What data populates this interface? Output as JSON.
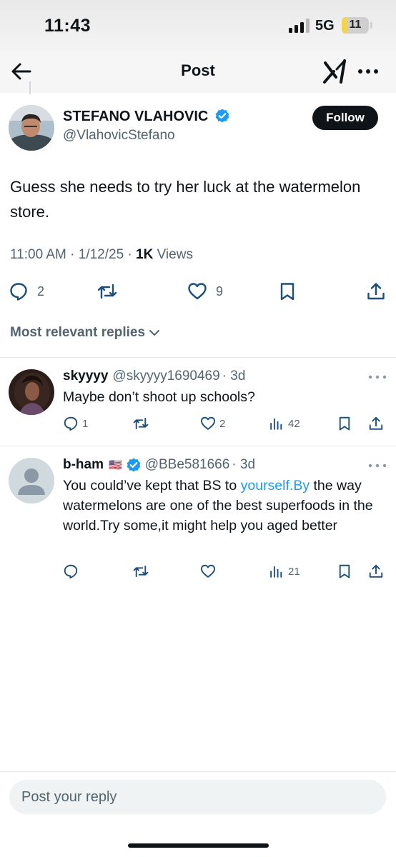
{
  "status_bar": {
    "time": "11:43",
    "network": "5G",
    "battery": "11",
    "battery_level": 0.11,
    "battery_color": "#f2d54b"
  },
  "nav": {
    "title": "Post",
    "icons": [
      "back-arrow-icon",
      "grok-icon",
      "more-icon"
    ]
  },
  "post": {
    "author_name": "STEFANO VLAHOVIC",
    "author_handle": "@VlahovicStefano",
    "verified": true,
    "follow_label": "Follow",
    "text": "Guess she needs to try her luck at the watermelon store.",
    "timestamp": "11:00 AM · 1/12/25 · ",
    "views_count": "1K",
    "views_label": " Views",
    "replies": "2",
    "likes": "9"
  },
  "sort": {
    "label": "Most relevant replies"
  },
  "replies": [
    {
      "name": "skyyyy",
      "handle": "@skyyyy1690469",
      "time": "· 3d",
      "text": "Maybe don’t shoot up schools?",
      "reply_count": "1",
      "repost_count": "",
      "like_count": "2",
      "view_count": "42"
    },
    {
      "name": "b-ham",
      "flag": "🇺🇸",
      "verified": true,
      "handle": "@BBe581666",
      "time": "· 3d",
      "text_before": "You could’ve kept that BS to ",
      "text_link": "yourself.By",
      "text_after": " the way watermelons are one of the best superfoods in the world.Try some,it might help you aged better",
      "reply_count": "",
      "repost_count": "",
      "like_count": "",
      "view_count": "21"
    }
  ],
  "composer": {
    "placeholder": "Post your reply"
  },
  "colors": {
    "text_primary": "#0f1419",
    "text_secondary": "#536471",
    "link": "#1d9bf0",
    "verified": "#1d9bf0"
  }
}
